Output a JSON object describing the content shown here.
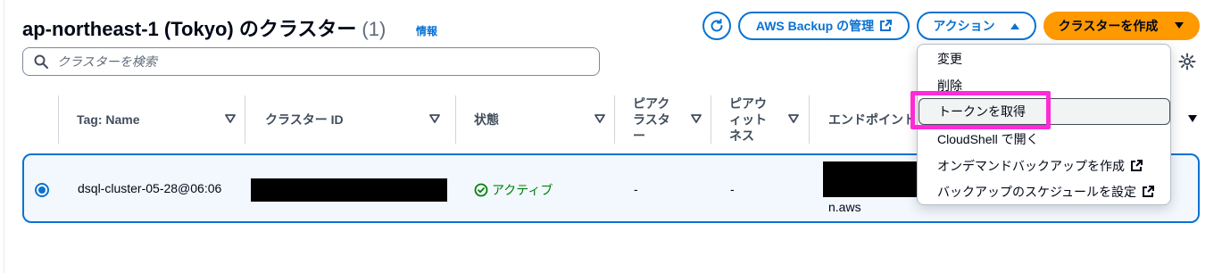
{
  "header": {
    "title": "ap-northeast-1 (Tokyo) のクラスター",
    "count": "(1)",
    "info_link": "情報"
  },
  "toolbar": {
    "refresh_icon": "refresh-icon",
    "backup_label": "AWS Backup の管理",
    "actions_label": "アクション",
    "create_label": "クラスターを作成"
  },
  "search": {
    "placeholder": "クラスターを検索"
  },
  "table": {
    "columns": [
      {
        "label": "Tag: Name"
      },
      {
        "label": "クラスター ID"
      },
      {
        "label": "状態"
      },
      {
        "label": "ピアクラスター"
      },
      {
        "label": "ピアウィットネス"
      },
      {
        "label": "エンドポイント"
      }
    ],
    "rows": [
      {
        "name": "dsql-cluster-05-28@06:06",
        "status": "アクティブ",
        "peer_cluster": "-",
        "peer_witness": "-",
        "endpoint_suffix": "n.aws"
      }
    ]
  },
  "menu": {
    "items": [
      {
        "label": "変更"
      },
      {
        "label": "削除"
      },
      {
        "label": "トークンを取得"
      },
      {
        "label": "CloudShell で開く"
      },
      {
        "label": "オンデマンドバックアップを作成"
      },
      {
        "label": "バックアップのスケジュールを設定"
      }
    ]
  },
  "colors": {
    "accent": "#0972d3",
    "primary_button": "#ff9900",
    "status_active": "#037f0c",
    "highlight": "#ff2bd6"
  }
}
